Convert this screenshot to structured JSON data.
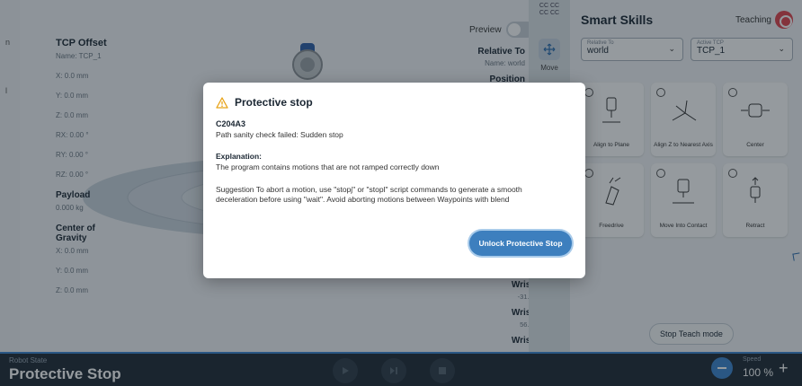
{
  "left_strip": {
    "chars": [
      "n",
      "l"
    ]
  },
  "tcp": {
    "heading": "TCP Offset",
    "name": "Name: TCP_1",
    "x": "X: 0.0 mm",
    "y": "Y: 0.0 mm",
    "z": "Z: 0.0 mm",
    "rx": "RX: 0.00 °",
    "ry": "RY: 0.00 °",
    "rz": "RZ: 0.00 °",
    "payload_heading": "Payload",
    "payload_value": "0.000 kg",
    "cog_heading": "Center of Gravity",
    "cog_x": "X: 0.0 mm",
    "cog_y": "Y: 0.0 mm",
    "cog_z": "Z: 0.0 mm"
  },
  "preview": {
    "label": "Preview"
  },
  "relative_to": {
    "heading": "Relative To",
    "name": "Name: world",
    "position": "Position"
  },
  "joints": [
    {
      "name": "Wrist 1",
      "value": "-31.34 °"
    },
    {
      "name": "Wrist 2",
      "value": "56.57 °"
    },
    {
      "name": "Wrist 3",
      "value": ""
    }
  ],
  "mid_strip": {
    "code_line1": "CC CC",
    "code_line2": "CC CC",
    "move_label": "Move"
  },
  "smart_skills": {
    "title": "Smart Skills",
    "teaching_label": "Teaching",
    "relative_to": {
      "label": "Relative To",
      "value": "world"
    },
    "active_tcp": {
      "label": "Active TCP",
      "value": "TCP_1"
    },
    "skills": [
      {
        "label": "Align to Plane",
        "icon": "align-to-plane-icon"
      },
      {
        "label": "Align Z to Nearest Axis",
        "icon": "align-z-axis-icon"
      },
      {
        "label": "Center",
        "icon": "center-icon"
      },
      {
        "label": "Freedrive",
        "icon": "freedrive-icon"
      },
      {
        "label": "Move Into Contact",
        "icon": "move-into-contact-icon"
      },
      {
        "label": "Retract",
        "icon": "retract-icon"
      }
    ],
    "stop_teach_label": "Stop Teach mode"
  },
  "bottom_bar": {
    "robot_state_label": "Robot State",
    "robot_state_value": "Protective Stop",
    "speed_label": "Speed",
    "speed_value": "100 %",
    "accent": "#3c85d0"
  },
  "modal": {
    "title": "Protective stop",
    "code": "C204A3",
    "message": "Path sanity check failed: Sudden stop",
    "explanation_heading": "Explanation:",
    "explanation": "The program contains motions that are not ramped correctly down",
    "suggestion": "Suggestion To abort a motion, use \"stopj\" or \"stopl\" script commands to generate a smooth deceleration before using \"wait\". Avoid aborting motions between Waypoints with blend",
    "unlock_button": "Unlock Protective Stop",
    "warning_color": "#e8a317"
  }
}
